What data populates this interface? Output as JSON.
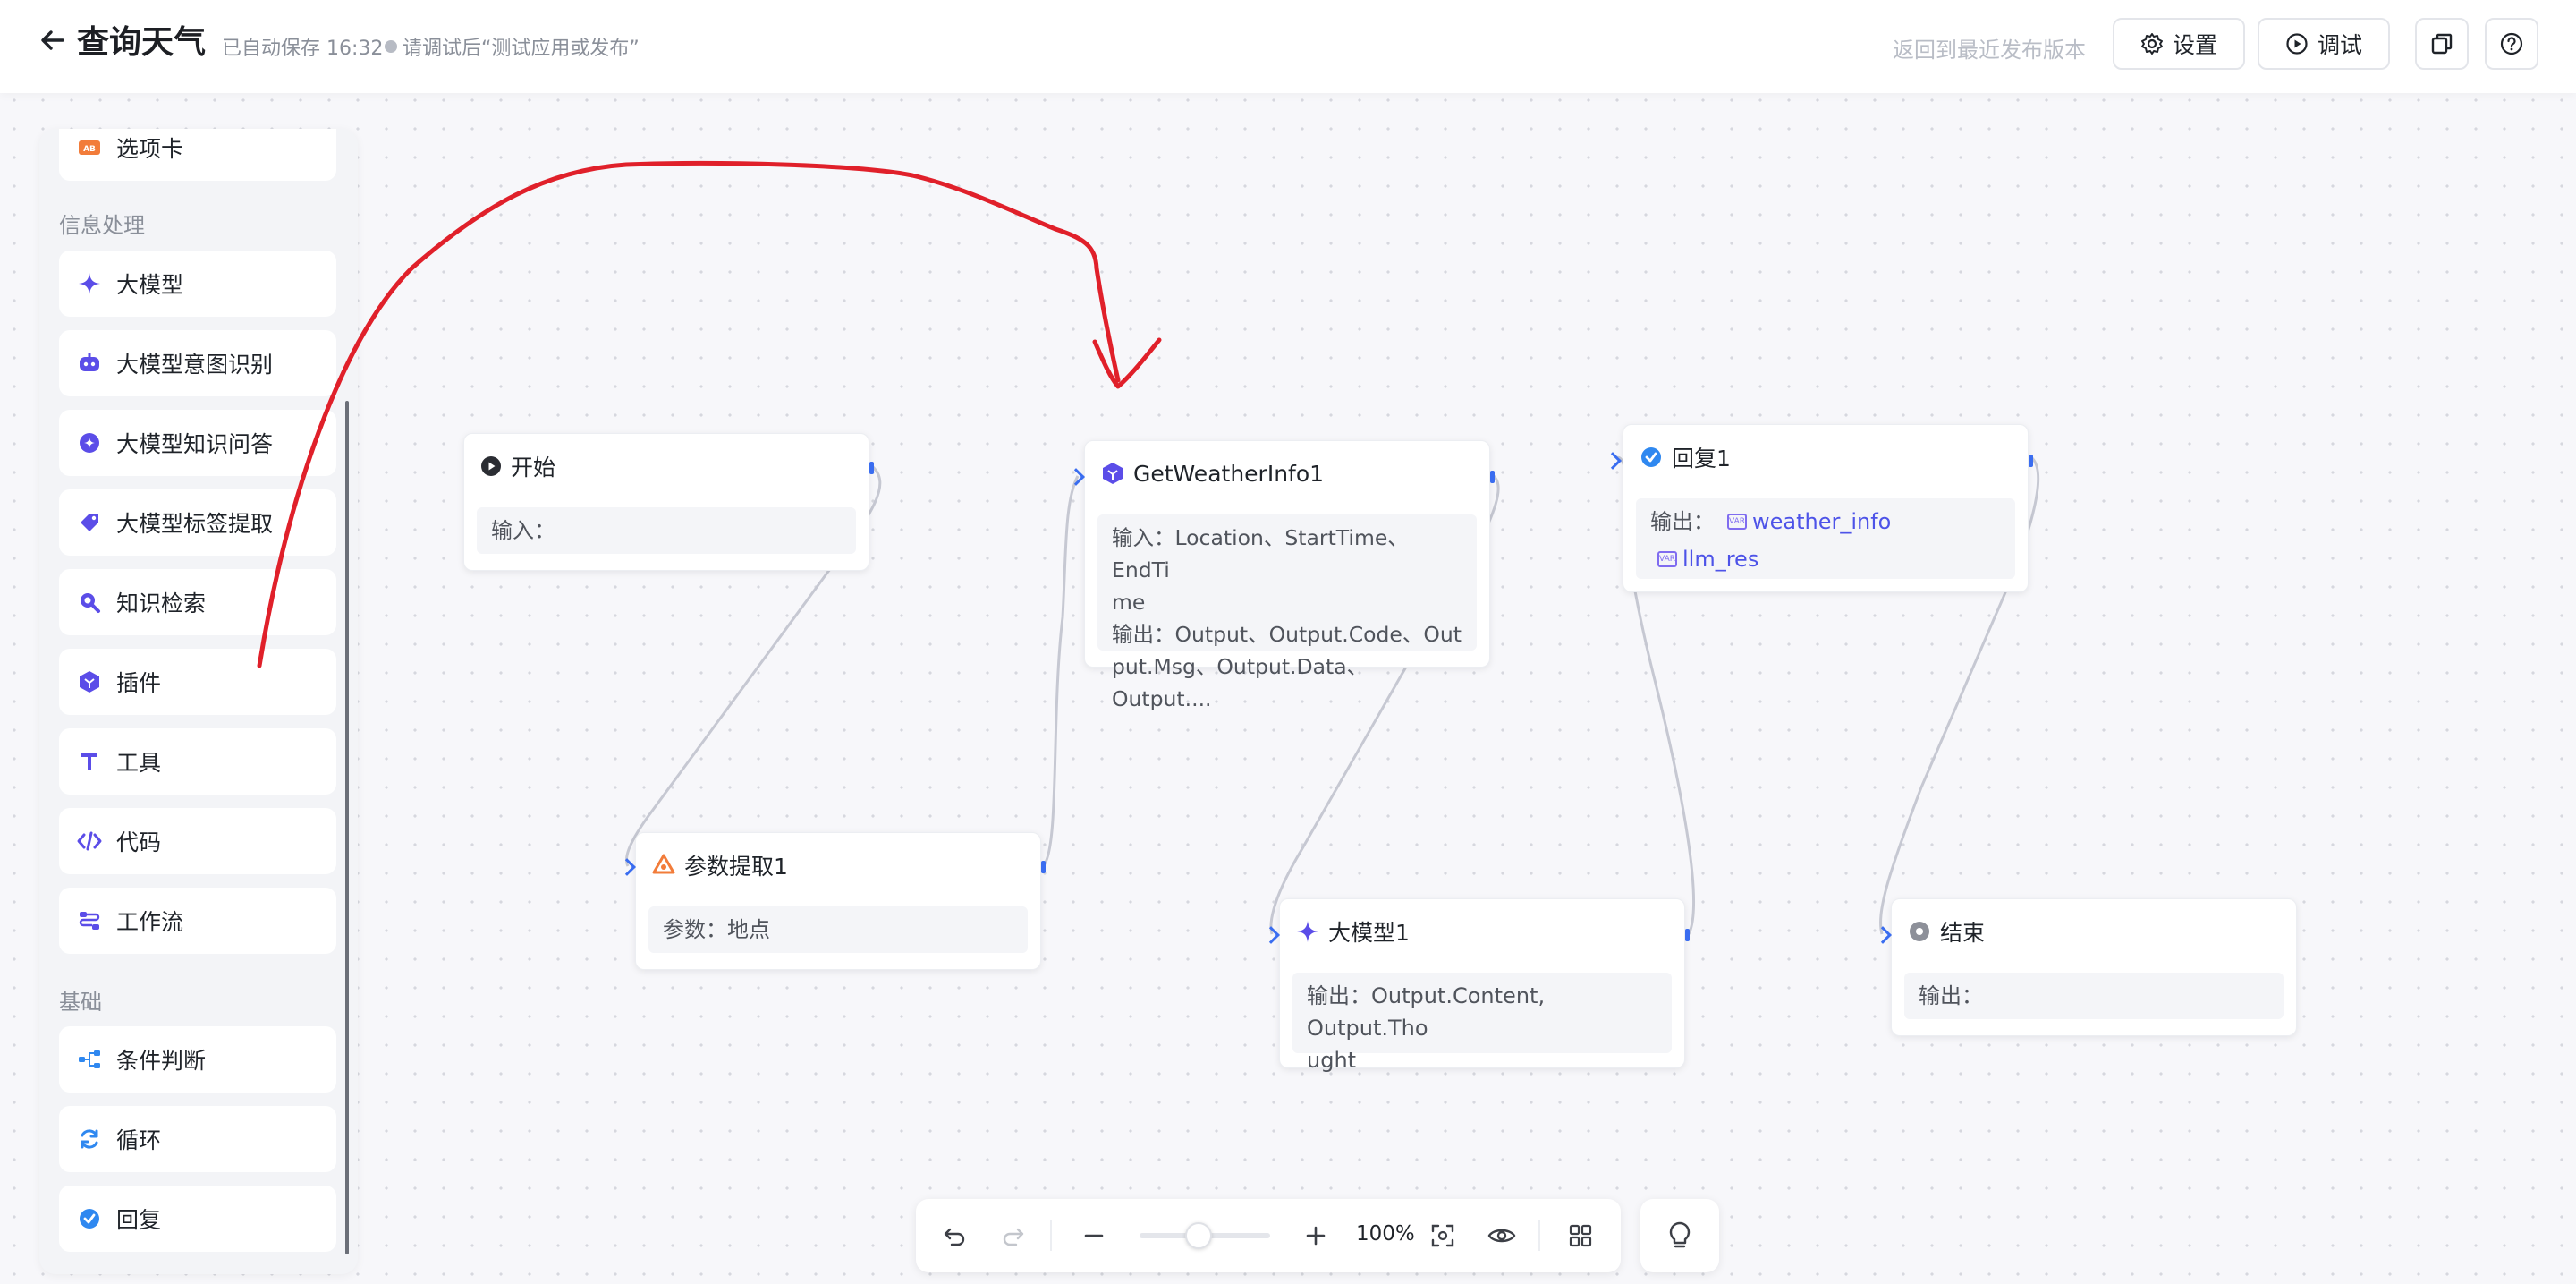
{
  "header": {
    "title": "查询天气",
    "autosave": "已自动保存 16:32",
    "hint": "请调试后“测试应用或发布”",
    "revert": "返回到最近发布版本",
    "settings_label": "设置",
    "debug_label": "调试"
  },
  "sidebar": {
    "top_item": "选项卡",
    "section_info": "信息处理",
    "info_items": [
      "大模型",
      "大模型意图识别",
      "大模型知识问答",
      "大模型标签提取",
      "知识检索",
      "插件",
      "工具",
      "代码",
      "工作流"
    ],
    "section_basic": "基础",
    "basic_items": [
      "条件判断",
      "循环",
      "回复"
    ]
  },
  "nodes": {
    "start": {
      "title": "开始",
      "body": "输入："
    },
    "param": {
      "title": "参数提取1",
      "body": "参数：地点"
    },
    "weather": {
      "title": "GetWeatherInfo1",
      "input_line1": "输入：Location、StartTime、EndTi",
      "input_line2": "me",
      "output_line1": "输出：Output、Output.Code、Out",
      "output_line2": "put.Msg、Output.Data、Output...."
    },
    "llm": {
      "title": "大模型1",
      "line1": "输出：Output.Content, Output.Tho",
      "line2": "ught"
    },
    "reply": {
      "title": "回复1",
      "label": "输出：",
      "var1": "weather_info",
      "var2": "llm_res",
      "var_badge": "VAR"
    },
    "end": {
      "title": "结束",
      "body": "输出："
    }
  },
  "toolbar": {
    "zoom": "100%",
    "zoom_fraction": 0.45
  },
  "colors": {
    "accent": "#4d53e8",
    "port": "#3a6df0",
    "annotation": "#e0202a",
    "edge": "#c6c8d2"
  },
  "icons": {
    "back": "arrow-left-icon",
    "settings": "gear-icon",
    "debug": "play-circle-icon",
    "copy": "copy-icon",
    "help": "question-icon",
    "bulb": "bulb-icon"
  }
}
